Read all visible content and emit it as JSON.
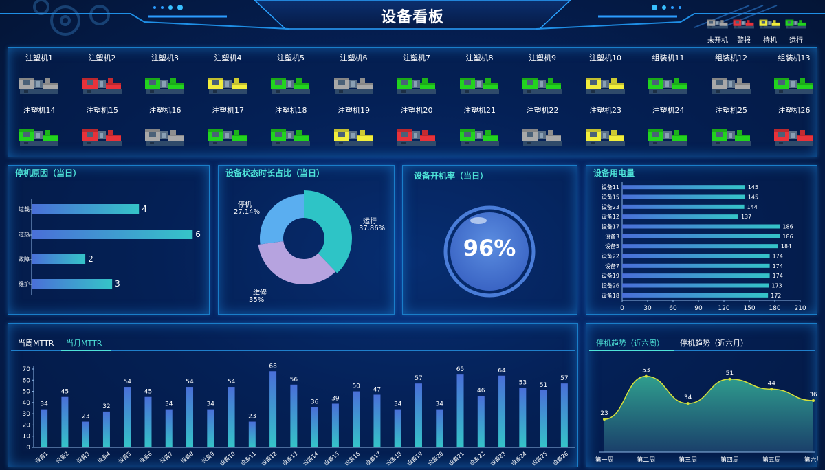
{
  "header": {
    "title": "设备看板"
  },
  "legend": [
    {
      "label": "未开机",
      "color": "#a8a8a8"
    },
    {
      "label": "警报",
      "color": "#e8323a"
    },
    {
      "label": "待机",
      "color": "#f2ee3c"
    },
    {
      "label": "运行",
      "color": "#22d41e"
    }
  ],
  "machines": [
    {
      "name": "注塑机1",
      "color": "#a8a8a8"
    },
    {
      "name": "注塑机2",
      "color": "#e8323a"
    },
    {
      "name": "注塑机3",
      "color": "#22d41e"
    },
    {
      "name": "注塑机4",
      "color": "#f2ee3c"
    },
    {
      "name": "注塑机5",
      "color": "#22d41e"
    },
    {
      "name": "注塑机6",
      "color": "#a8a8a8"
    },
    {
      "name": "注塑机7",
      "color": "#22d41e"
    },
    {
      "name": "注塑机8",
      "color": "#22d41e"
    },
    {
      "name": "注塑机9",
      "color": "#22d41e"
    },
    {
      "name": "注塑机10",
      "color": "#f2ee3c"
    },
    {
      "name": "组装机11",
      "color": "#22d41e"
    },
    {
      "name": "组装机12",
      "color": "#a8a8a8"
    },
    {
      "name": "组装机13",
      "color": "#22d41e"
    },
    {
      "name": "注塑机14",
      "color": "#22d41e"
    },
    {
      "name": "注塑机15",
      "color": "#e8323a"
    },
    {
      "name": "注塑机16",
      "color": "#a8a8a8"
    },
    {
      "name": "注塑机17",
      "color": "#22d41e"
    },
    {
      "name": "注塑机18",
      "color": "#22d41e"
    },
    {
      "name": "注塑机19",
      "color": "#f2ee3c"
    },
    {
      "name": "注塑机20",
      "color": "#e8323a"
    },
    {
      "name": "注塑机21",
      "color": "#22d41e"
    },
    {
      "name": "注塑机22",
      "color": "#a8a8a8"
    },
    {
      "name": "注塑机23",
      "color": "#f2ee3c"
    },
    {
      "name": "注塑机24",
      "color": "#22d41e"
    },
    {
      "name": "注塑机25",
      "color": "#22d41e"
    },
    {
      "name": "注塑机26",
      "color": "#e8323a"
    }
  ],
  "stop_reason": {
    "title": "停机原因（当日）"
  },
  "status_ratio": {
    "title": "设备状态时长占比（当日）"
  },
  "uptime": {
    "title": "设备开机率（当日）",
    "value": "96%"
  },
  "power": {
    "title": "设备用电量"
  },
  "mttr": {
    "tabs": [
      "当周MTTR",
      "当月MTTR"
    ],
    "active_tab": 1
  },
  "trend": {
    "tabs": [
      "停机趋势（近六周）",
      "停机趋势（近六月）"
    ],
    "active_tab": 0
  },
  "chart_data": [
    {
      "type": "bar",
      "orientation": "horizontal",
      "title": "停机原因（当日）",
      "categories": [
        "过载",
        "过热",
        "故障",
        "维护"
      ],
      "values": [
        4,
        6,
        2,
        3
      ]
    },
    {
      "type": "pie",
      "title": "设备状态时长占比（当日）",
      "slices": [
        {
          "label": "运行",
          "value": 37.86,
          "text": "37.86%",
          "color": "#2ec4c6"
        },
        {
          "label": "维修",
          "value": 35,
          "text": "35%",
          "color": "#b6a3df"
        },
        {
          "label": "停机",
          "value": 27.14,
          "text": "27.14%",
          "color": "#5aaef0"
        }
      ]
    },
    {
      "type": "bar",
      "orientation": "horizontal",
      "title": "设备用电量",
      "categories": [
        "设备11",
        "设备15",
        "设备23",
        "设备12",
        "设备17",
        "设备3",
        "设备5",
        "设备22",
        "设备7",
        "设备19",
        "设备26",
        "设备18"
      ],
      "values": [
        145,
        145,
        144,
        137,
        186,
        186,
        184,
        174,
        174,
        174,
        173,
        172
      ],
      "xticks": [
        "0",
        "30",
        "60",
        "90",
        "120",
        "150",
        "180",
        "210"
      ],
      "xlim": [
        0,
        210
      ]
    },
    {
      "type": "bar",
      "title": "当月MTTR",
      "categories": [
        "设备1",
        "设备2",
        "设备3",
        "设备4",
        "设备5",
        "设备6",
        "设备7",
        "设备8",
        "设备9",
        "设备10",
        "设备11",
        "设备12",
        "设备13",
        "设备14",
        "设备15",
        "设备16",
        "设备17",
        "设备18",
        "设备19",
        "设备20",
        "设备21",
        "设备22",
        "设备23",
        "设备24",
        "设备25",
        "设备26"
      ],
      "values": [
        34,
        45,
        23,
        32,
        54,
        45,
        34,
        54,
        34,
        54,
        23,
        68,
        56,
        36,
        39,
        50,
        47,
        34,
        57,
        34,
        65,
        46,
        64,
        53,
        51,
        57
      ],
      "yticks": [
        "0",
        "10",
        "20",
        "30",
        "40",
        "50",
        "60",
        "70"
      ],
      "ylim": [
        0,
        70
      ]
    },
    {
      "type": "area",
      "title": "停机趋势（近六周）",
      "categories": [
        "第一周",
        "第二周",
        "第三周",
        "第四周",
        "第五周",
        "第六周"
      ],
      "values": [
        23,
        53,
        34,
        51,
        44,
        36
      ]
    }
  ]
}
